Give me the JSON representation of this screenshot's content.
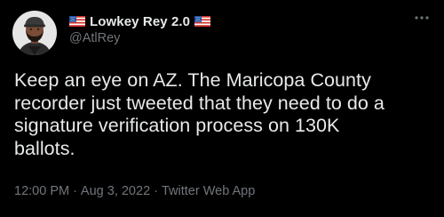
{
  "author": {
    "display_name": "Lowkey Rey 2.0",
    "handle": "@AtlRey",
    "flag_icon": "us-flag-emoji"
  },
  "tweet": {
    "text_lines": [
      "Keep an eye on AZ. The Maricopa County",
      "recorder just tweeted that they need to do a",
      "signature verification process on 130K",
      "ballots."
    ]
  },
  "meta": {
    "time": "12:00 PM",
    "separator": "·",
    "date": "Aug 3, 2022",
    "source": "Twitter Web App"
  },
  "icons": {
    "more": "more-horizontal-icon"
  },
  "colors": {
    "background": "#000000",
    "text_primary": "#e7e9ea",
    "text_secondary": "#71767b"
  }
}
